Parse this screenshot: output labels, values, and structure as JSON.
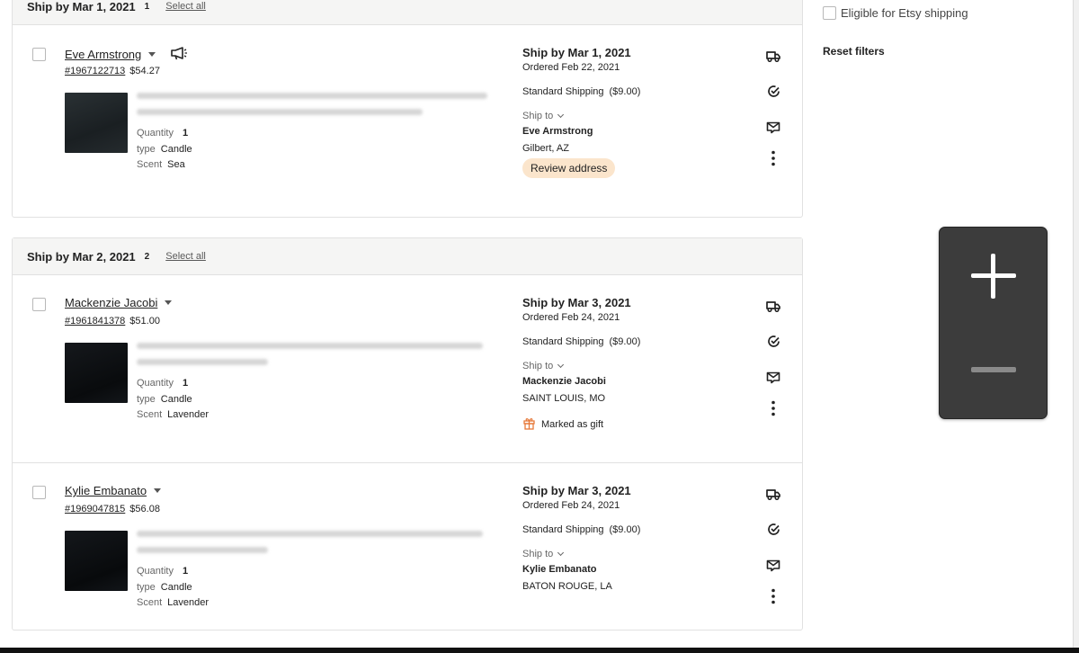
{
  "groups": [
    {
      "title": "Ship by Mar 1, 2021",
      "count": "1",
      "select_all": "Select all",
      "orders": [
        {
          "buyer": "Eve Armstrong",
          "order_number": "#1967122713",
          "price": "$54.27",
          "quantity_label": "Quantity",
          "quantity": "1",
          "type_label": "type",
          "type": "Candle",
          "scent_label": "Scent",
          "scent": "Sea",
          "ship_by": "Ship by Mar 1, 2021",
          "ordered": "Ordered Feb 22, 2021",
          "shipping_method": "Standard Shipping",
          "shipping_cost": "($9.00)",
          "ship_to_label": "Ship to",
          "recipient": "Eve Armstrong",
          "address": "Gilbert, AZ",
          "review_badge": "Review address",
          "thumb_color": "#1f2527"
        }
      ]
    },
    {
      "title": "Ship by Mar 2, 2021",
      "count": "2",
      "select_all": "Select all",
      "orders": [
        {
          "buyer": "Mackenzie Jacobi",
          "order_number": "#1961841378",
          "price": "$51.00",
          "quantity_label": "Quantity",
          "quantity": "1",
          "type_label": "type",
          "type": "Candle",
          "scent_label": "Scent",
          "scent": "Lavender",
          "ship_by": "Ship by Mar 3, 2021",
          "ordered": "Ordered Feb 24, 2021",
          "shipping_method": "Standard Shipping",
          "shipping_cost": "($9.00)",
          "ship_to_label": "Ship to",
          "recipient": "Mackenzie Jacobi",
          "address": "SAINT LOUIS, MO",
          "gift_label": "Marked as gift",
          "thumb_color": "#0d0f12"
        },
        {
          "buyer": "Kylie Embanato",
          "order_number": "#1969047815",
          "price": "$56.08",
          "quantity_label": "Quantity",
          "quantity": "1",
          "type_label": "type",
          "type": "Candle",
          "scent_label": "Scent",
          "scent": "Lavender",
          "ship_by": "Ship by Mar 3, 2021",
          "ordered": "Ordered Feb 24, 2021",
          "shipping_method": "Standard Shipping",
          "shipping_cost": "($9.00)",
          "ship_to_label": "Ship to",
          "recipient": "Kylie Embanato",
          "address": "BATON ROUGE, LA",
          "thumb_color": "#0c0e11"
        }
      ]
    }
  ],
  "sidebar": {
    "eligible_label": "Eligible for Etsy shipping",
    "reset_filters": "Reset filters"
  },
  "icons": {
    "truck": "truck-icon",
    "complete": "check-circle-icon",
    "message": "message-icon",
    "more": "more-vertical-icon",
    "megaphone": "megaphone-icon",
    "gift": "gift-icon",
    "zoom_in": "zoom-in-icon",
    "zoom_out": "zoom-out-icon"
  },
  "colors": {
    "review_badge_bg": "#fbe5cc",
    "gift_icon": "#e6793a",
    "header_bg": "#f5f5f4"
  }
}
